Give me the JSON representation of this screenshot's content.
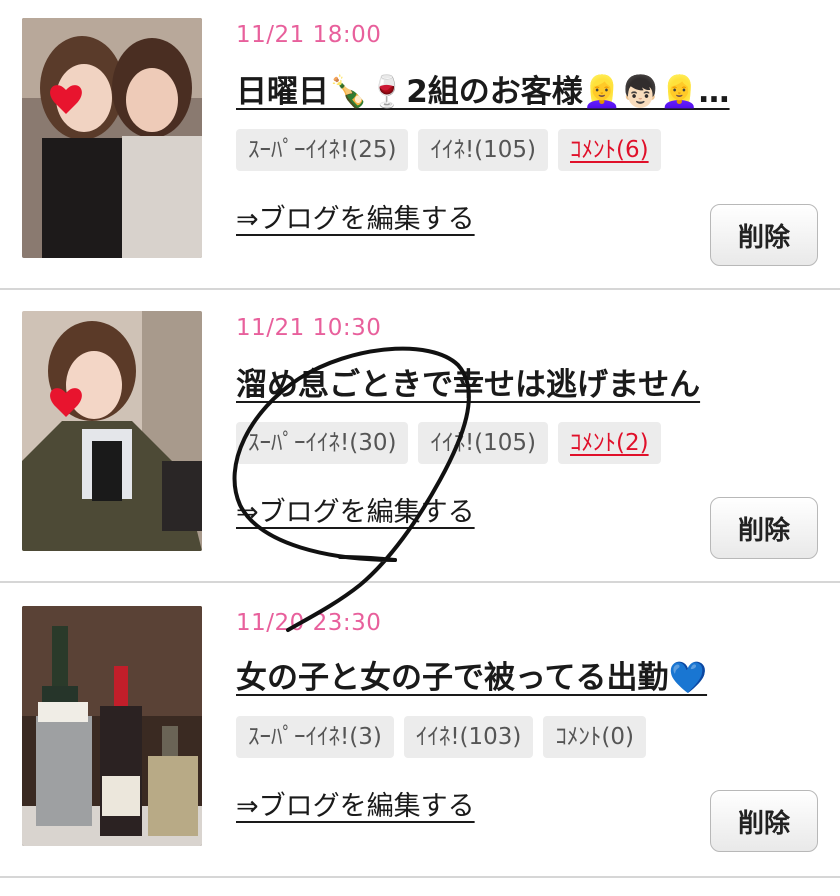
{
  "entries": [
    {
      "date": "11/21 18:00",
      "title": "日曜日🍾🍷2組のお客様👱‍♀️👦🏻👱‍♀️…",
      "super_like": "ｽｰﾊﾟｰｲｲﾈ!(25)",
      "like": "ｲｲﾈ!(105)",
      "comment": "ｺﾒﾝﾄ(6)",
      "edit_label": "⇒ブログを編集する",
      "delete_label": "削除"
    },
    {
      "date": "11/21 10:30",
      "title": "溜め息ごときで幸せは逃げません",
      "super_like": "ｽｰﾊﾟｰｲｲﾈ!(30)",
      "like": "ｲｲﾈ!(105)",
      "comment": "ｺﾒﾝﾄ(2)",
      "edit_label": "⇒ブログを編集する",
      "delete_label": "削除"
    },
    {
      "date": "11/20 23:30",
      "title": "女の子と女の子で被ってる出勤💙",
      "super_like": "ｽｰﾊﾟｰｲｲﾈ!(3)",
      "like": "ｲｲﾈ!(103)",
      "comment": "ｺﾒﾝﾄ(0)",
      "edit_label": "⇒ブログを編集する",
      "delete_label": "削除"
    }
  ],
  "colors": {
    "date": "#e8609c",
    "comment_active": "#e0102a",
    "tag_bg": "#ececec"
  }
}
